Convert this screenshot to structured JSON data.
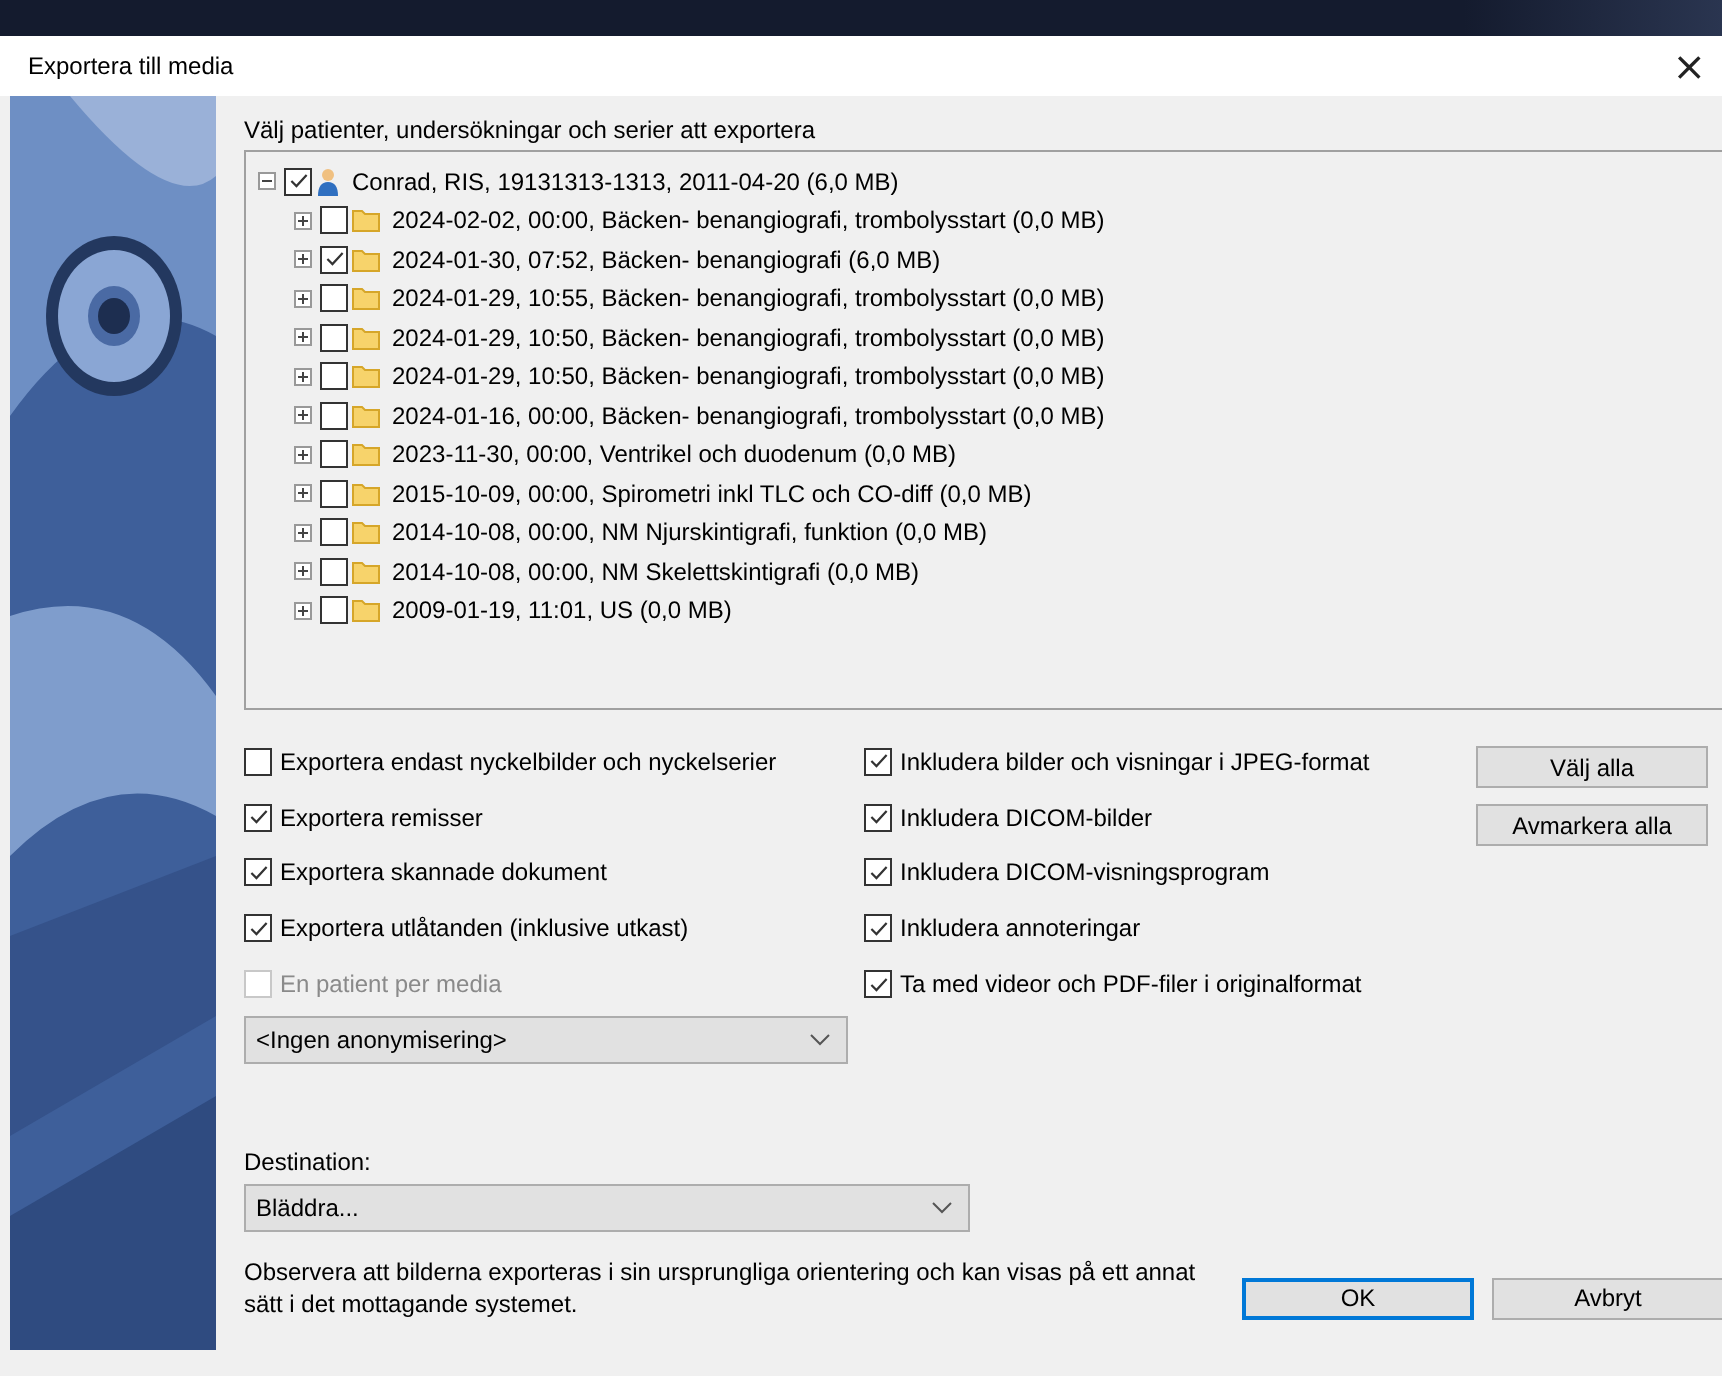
{
  "window": {
    "title": "Exportera till media",
    "close": "×"
  },
  "tree_label": "Välj patienter, undersökningar och serier att exportera",
  "tree": [
    {
      "kind": "patient",
      "label": "Conrad, RIS, 19131313-1313, 2011-04-20 (6,0 MB)",
      "checked": true,
      "expanded": true,
      "children": [
        {
          "kind": "folder",
          "label": "2024-02-02, 00:00, Bäcken- benangiografi, trombolysstart (0,0 MB)",
          "checked": false,
          "expanded": false
        },
        {
          "kind": "folder",
          "label": "2024-01-30, 07:52, Bäcken- benangiografi (6,0 MB)",
          "checked": true,
          "expanded": false
        },
        {
          "kind": "folder",
          "label": "2024-01-29, 10:55, Bäcken- benangiografi, trombolysstart (0,0 MB)",
          "checked": false,
          "expanded": false
        },
        {
          "kind": "folder",
          "label": "2024-01-29, 10:50, Bäcken- benangiografi, trombolysstart (0,0 MB)",
          "checked": false,
          "expanded": false
        },
        {
          "kind": "folder",
          "label": "2024-01-29, 10:50, Bäcken- benangiografi, trombolysstart (0,0 MB)",
          "checked": false,
          "expanded": false
        },
        {
          "kind": "folder",
          "label": "2024-01-16, 00:00, Bäcken- benangiografi, trombolysstart (0,0 MB)",
          "checked": false,
          "expanded": false
        },
        {
          "kind": "folder",
          "label": "2023-11-30, 00:00, Ventrikel och duodenum (0,0 MB)",
          "checked": false,
          "expanded": false
        },
        {
          "kind": "folder",
          "label": "2015-10-09, 00:00, Spirometri inkl TLC och CO-diff (0,0 MB)",
          "checked": false,
          "expanded": false
        },
        {
          "kind": "folder",
          "label": "2014-10-08, 00:00, NM Njurskintigrafi, funktion (0,0 MB)",
          "checked": false,
          "expanded": false
        },
        {
          "kind": "folder",
          "label": "2014-10-08, 00:00, NM Skelettskintigrafi (0,0 MB)",
          "checked": false,
          "expanded": false
        },
        {
          "kind": "folder",
          "label": "2009-01-19, 11:01, US (0,0 MB)",
          "checked": false,
          "expanded": false
        }
      ]
    }
  ],
  "export_options": [
    {
      "label": "Exportera endast nyckelbilder och nyckelserier",
      "checked": false,
      "disabled": false
    },
    {
      "label": "Exportera remisser",
      "checked": true,
      "disabled": false
    },
    {
      "label": "Exportera skannade dokument",
      "checked": true,
      "disabled": false
    },
    {
      "label": "Exportera utlåtanden (inklusive utkast)",
      "checked": true,
      "disabled": false
    },
    {
      "label": "En patient per media",
      "checked": false,
      "disabled": true
    }
  ],
  "include_options": [
    {
      "label": "Inkludera bilder och visningar i JPEG-format",
      "checked": true
    },
    {
      "label": "Inkludera DICOM-bilder",
      "checked": true
    },
    {
      "label": "Inkludera DICOM-visningsprogram",
      "checked": true
    },
    {
      "label": "Inkludera annoteringar",
      "checked": true
    },
    {
      "label": "Ta med videor och PDF-filer i originalformat",
      "checked": true
    }
  ],
  "side_buttons": [
    "Välj alla",
    "Avmarkera alla"
  ],
  "anonymization": {
    "value": "<Ingen anonymisering>"
  },
  "destination": {
    "label": "Destination:",
    "value": "Bläddra..."
  },
  "note": "Observera att bilderna exporteras i sin ursprungliga orientering och kan visas på ett annat sätt i det mottagande systemet.",
  "buttons": [
    {
      "label": "OK",
      "default": true
    },
    {
      "label": "Avbryt",
      "default": false
    }
  ]
}
